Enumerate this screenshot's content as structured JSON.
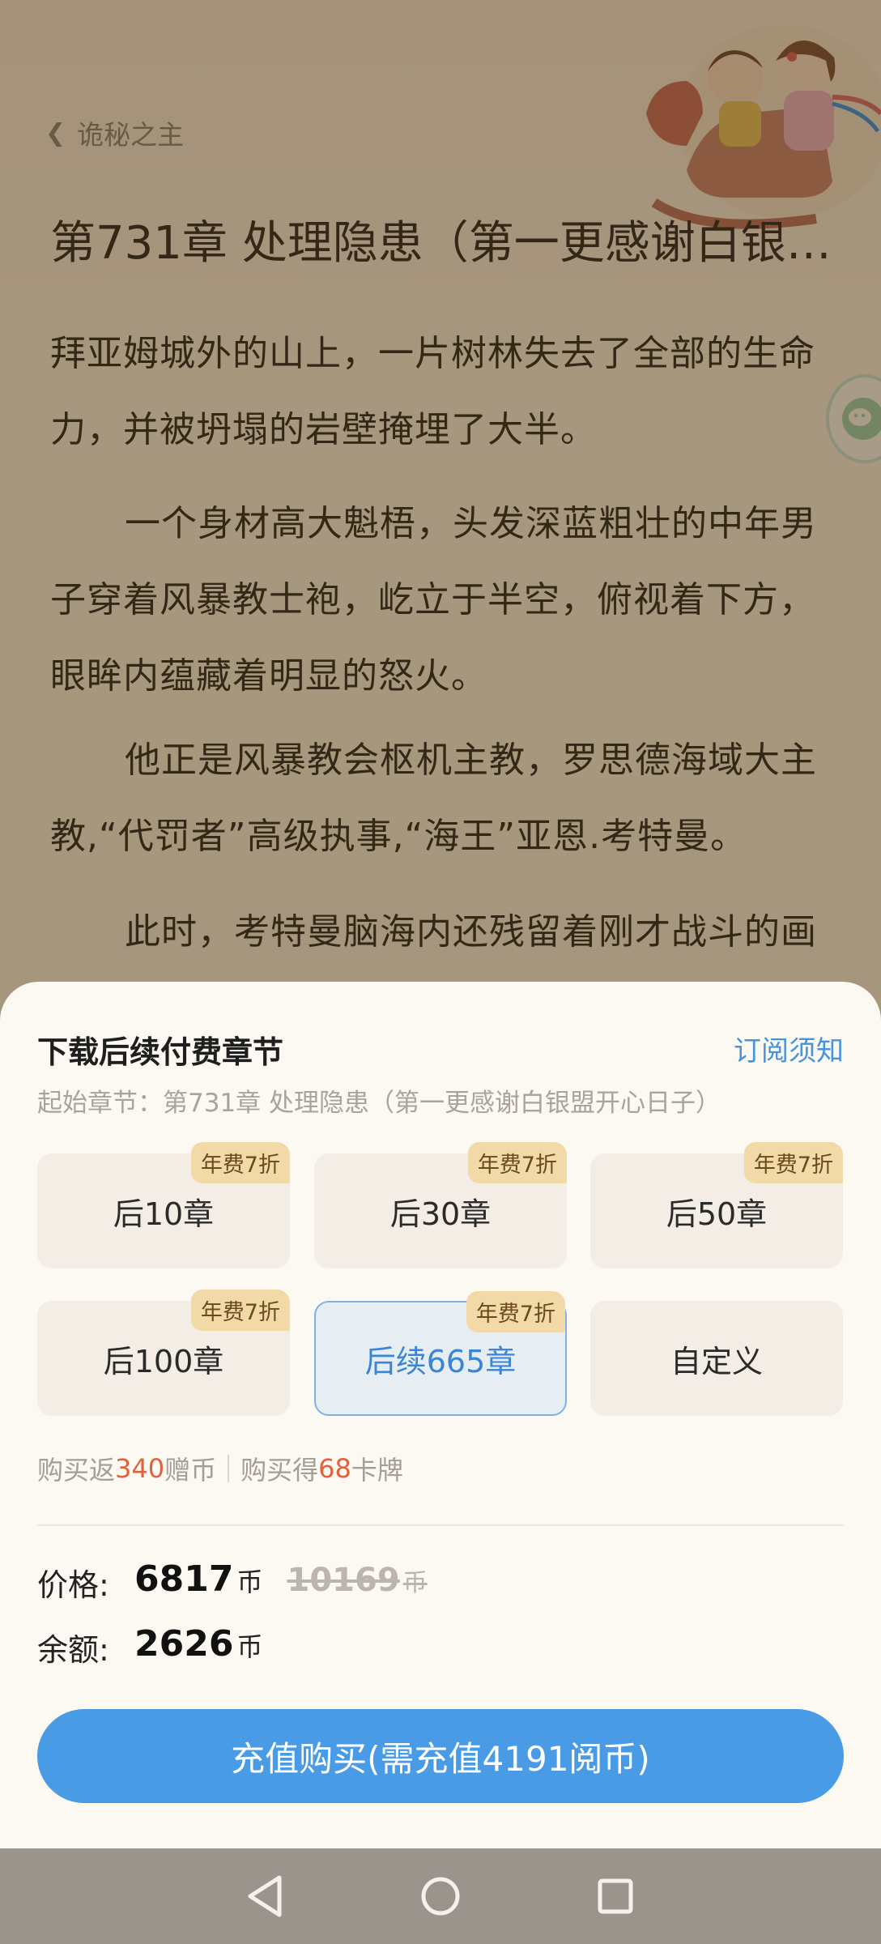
{
  "reader": {
    "back_label": "诡秘之主",
    "chapter_title": "第731章 处理隐患（第一更感谢白银…",
    "paragraphs": [
      "拜亚姆城外的山上，一片树林失去了全部的生命力，并被坍塌的岩壁掩埋了大半。",
      "一个身材高大魁梧，头发深蓝粗壮的中年男子穿着风暴教士袍，屹立于半空，俯视着下方，眼眸内蕴藏着明显的怒火。",
      "他正是风暴教会枢机主教，罗思德海域大主教,“代罚者”高级执事,“海王”亚恩.考特曼。",
      "此时，考特曼脑海内还残留着刚才战斗的画"
    ]
  },
  "sheet": {
    "title": "下载后续付费章节",
    "notice_link": "订阅须知",
    "start_chapter": "起始章节：第731章 处理隐患（第一更感谢白银盟开心日子）",
    "options": [
      {
        "label": "后10章",
        "badge": "年费7折"
      },
      {
        "label": "后30章",
        "badge": "年费7折"
      },
      {
        "label": "后50章",
        "badge": "年费7折"
      },
      {
        "label": "后100章",
        "badge": "年费7折"
      },
      {
        "label": "后续665章",
        "badge": "年费7折"
      },
      {
        "label": "自定义",
        "badge": ""
      }
    ],
    "selected_option": "后续665章",
    "perks": {
      "buy_return_prefix": "购买返",
      "buy_return_value": "340",
      "buy_return_suffix": "赠币",
      "buy_get_prefix": "购买得",
      "buy_get_value": "68",
      "buy_get_suffix": "卡牌"
    },
    "price_label": "价格:",
    "price_value": "6817",
    "price_unit": "币",
    "original_price": "10169",
    "original_unit": "币",
    "balance_label": "余额:",
    "balance_value": "2626",
    "balance_unit": "币",
    "buy_button": "充值购买(需充值4191阅币)"
  },
  "colors": {
    "accent": "#4a9be6",
    "highlight": "#e0623c",
    "badge_bg": "#f2d9a8"
  },
  "navbar": {
    "icons": [
      "back-triangle-icon",
      "home-circle-icon",
      "recents-square-icon"
    ]
  }
}
